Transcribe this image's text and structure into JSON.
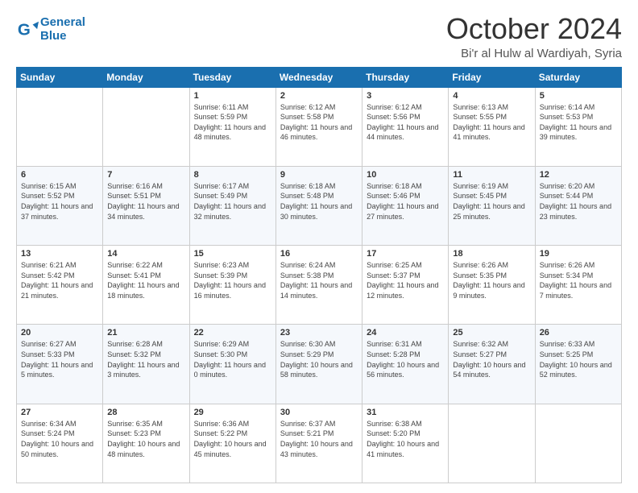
{
  "header": {
    "logo_line1": "General",
    "logo_line2": "Blue",
    "month": "October 2024",
    "location": "Bi'r al Hulw al Wardiyah, Syria"
  },
  "weekdays": [
    "Sunday",
    "Monday",
    "Tuesday",
    "Wednesday",
    "Thursday",
    "Friday",
    "Saturday"
  ],
  "weeks": [
    [
      {
        "day": "",
        "info": ""
      },
      {
        "day": "",
        "info": ""
      },
      {
        "day": "1",
        "info": "Sunrise: 6:11 AM\nSunset: 5:59 PM\nDaylight: 11 hours and 48 minutes."
      },
      {
        "day": "2",
        "info": "Sunrise: 6:12 AM\nSunset: 5:58 PM\nDaylight: 11 hours and 46 minutes."
      },
      {
        "day": "3",
        "info": "Sunrise: 6:12 AM\nSunset: 5:56 PM\nDaylight: 11 hours and 44 minutes."
      },
      {
        "day": "4",
        "info": "Sunrise: 6:13 AM\nSunset: 5:55 PM\nDaylight: 11 hours and 41 minutes."
      },
      {
        "day": "5",
        "info": "Sunrise: 6:14 AM\nSunset: 5:53 PM\nDaylight: 11 hours and 39 minutes."
      }
    ],
    [
      {
        "day": "6",
        "info": "Sunrise: 6:15 AM\nSunset: 5:52 PM\nDaylight: 11 hours and 37 minutes."
      },
      {
        "day": "7",
        "info": "Sunrise: 6:16 AM\nSunset: 5:51 PM\nDaylight: 11 hours and 34 minutes."
      },
      {
        "day": "8",
        "info": "Sunrise: 6:17 AM\nSunset: 5:49 PM\nDaylight: 11 hours and 32 minutes."
      },
      {
        "day": "9",
        "info": "Sunrise: 6:18 AM\nSunset: 5:48 PM\nDaylight: 11 hours and 30 minutes."
      },
      {
        "day": "10",
        "info": "Sunrise: 6:18 AM\nSunset: 5:46 PM\nDaylight: 11 hours and 27 minutes."
      },
      {
        "day": "11",
        "info": "Sunrise: 6:19 AM\nSunset: 5:45 PM\nDaylight: 11 hours and 25 minutes."
      },
      {
        "day": "12",
        "info": "Sunrise: 6:20 AM\nSunset: 5:44 PM\nDaylight: 11 hours and 23 minutes."
      }
    ],
    [
      {
        "day": "13",
        "info": "Sunrise: 6:21 AM\nSunset: 5:42 PM\nDaylight: 11 hours and 21 minutes."
      },
      {
        "day": "14",
        "info": "Sunrise: 6:22 AM\nSunset: 5:41 PM\nDaylight: 11 hours and 18 minutes."
      },
      {
        "day": "15",
        "info": "Sunrise: 6:23 AM\nSunset: 5:39 PM\nDaylight: 11 hours and 16 minutes."
      },
      {
        "day": "16",
        "info": "Sunrise: 6:24 AM\nSunset: 5:38 PM\nDaylight: 11 hours and 14 minutes."
      },
      {
        "day": "17",
        "info": "Sunrise: 6:25 AM\nSunset: 5:37 PM\nDaylight: 11 hours and 12 minutes."
      },
      {
        "day": "18",
        "info": "Sunrise: 6:26 AM\nSunset: 5:35 PM\nDaylight: 11 hours and 9 minutes."
      },
      {
        "day": "19",
        "info": "Sunrise: 6:26 AM\nSunset: 5:34 PM\nDaylight: 11 hours and 7 minutes."
      }
    ],
    [
      {
        "day": "20",
        "info": "Sunrise: 6:27 AM\nSunset: 5:33 PM\nDaylight: 11 hours and 5 minutes."
      },
      {
        "day": "21",
        "info": "Sunrise: 6:28 AM\nSunset: 5:32 PM\nDaylight: 11 hours and 3 minutes."
      },
      {
        "day": "22",
        "info": "Sunrise: 6:29 AM\nSunset: 5:30 PM\nDaylight: 11 hours and 0 minutes."
      },
      {
        "day": "23",
        "info": "Sunrise: 6:30 AM\nSunset: 5:29 PM\nDaylight: 10 hours and 58 minutes."
      },
      {
        "day": "24",
        "info": "Sunrise: 6:31 AM\nSunset: 5:28 PM\nDaylight: 10 hours and 56 minutes."
      },
      {
        "day": "25",
        "info": "Sunrise: 6:32 AM\nSunset: 5:27 PM\nDaylight: 10 hours and 54 minutes."
      },
      {
        "day": "26",
        "info": "Sunrise: 6:33 AM\nSunset: 5:25 PM\nDaylight: 10 hours and 52 minutes."
      }
    ],
    [
      {
        "day": "27",
        "info": "Sunrise: 6:34 AM\nSunset: 5:24 PM\nDaylight: 10 hours and 50 minutes."
      },
      {
        "day": "28",
        "info": "Sunrise: 6:35 AM\nSunset: 5:23 PM\nDaylight: 10 hours and 48 minutes."
      },
      {
        "day": "29",
        "info": "Sunrise: 6:36 AM\nSunset: 5:22 PM\nDaylight: 10 hours and 45 minutes."
      },
      {
        "day": "30",
        "info": "Sunrise: 6:37 AM\nSunset: 5:21 PM\nDaylight: 10 hours and 43 minutes."
      },
      {
        "day": "31",
        "info": "Sunrise: 6:38 AM\nSunset: 5:20 PM\nDaylight: 10 hours and 41 minutes."
      },
      {
        "day": "",
        "info": ""
      },
      {
        "day": "",
        "info": ""
      }
    ]
  ]
}
